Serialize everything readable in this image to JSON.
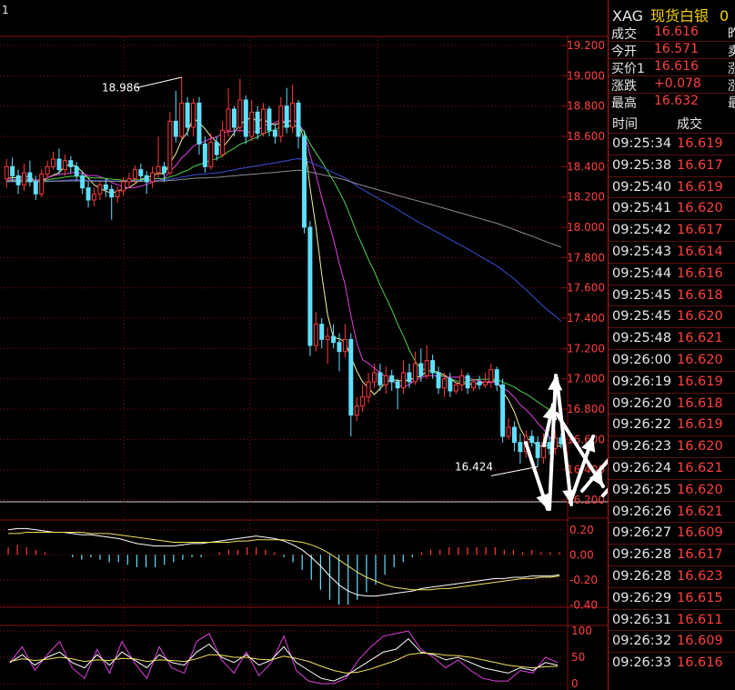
{
  "chart_data": {
    "type": "candlestick",
    "top_left_label": "1",
    "price_axis": {
      "ticks": [
        "19.200",
        "19.000",
        "18.800",
        "18.600",
        "18.400",
        "18.200",
        "18.000",
        "17.800",
        "17.600",
        "17.400",
        "17.200",
        "17.000",
        "16.800",
        "16.600",
        "16.400",
        "16.200"
      ],
      "range": [
        16.2,
        19.2
      ]
    },
    "annotations": {
      "high": "18.986",
      "low": "16.424"
    },
    "macd_axis": {
      "ticks": [
        "0.20",
        "0.00",
        "-0.20",
        "-0.40"
      ]
    },
    "kdj_axis": {
      "ticks": [
        "100",
        "50",
        "0"
      ]
    },
    "candles": [
      [
        18.32,
        18.4,
        18.45,
        18.26
      ],
      [
        18.4,
        18.34,
        18.46,
        18.3
      ],
      [
        18.34,
        18.28,
        18.38,
        18.22
      ],
      [
        18.28,
        18.36,
        18.42,
        18.24
      ],
      [
        18.36,
        18.3,
        18.44,
        18.27
      ],
      [
        18.3,
        18.22,
        18.34,
        18.18
      ],
      [
        18.22,
        18.35,
        18.38,
        18.2
      ],
      [
        18.35,
        18.4,
        18.44,
        18.32
      ],
      [
        18.4,
        18.45,
        18.5,
        18.38
      ],
      [
        18.45,
        18.38,
        18.52,
        18.35
      ],
      [
        18.38,
        18.44,
        18.48,
        18.34
      ],
      [
        18.44,
        18.4,
        18.47,
        18.36
      ],
      [
        18.4,
        18.34,
        18.43,
        18.31
      ],
      [
        18.34,
        18.26,
        18.37,
        18.22
      ],
      [
        18.26,
        18.18,
        18.3,
        18.13
      ],
      [
        18.18,
        18.22,
        18.26,
        18.14
      ],
      [
        18.22,
        18.28,
        18.3,
        18.18
      ],
      [
        18.28,
        18.25,
        18.32,
        18.2
      ],
      [
        18.25,
        18.2,
        18.28,
        18.05
      ],
      [
        18.2,
        18.24,
        18.27,
        18.16
      ],
      [
        18.24,
        18.3,
        18.33,
        18.21
      ],
      [
        18.3,
        18.32,
        18.36,
        18.26
      ],
      [
        18.32,
        18.38,
        18.41,
        18.28
      ],
      [
        18.38,
        18.34,
        18.42,
        18.3
      ],
      [
        18.34,
        18.3,
        18.37,
        18.22
      ],
      [
        18.3,
        18.36,
        18.4,
        18.26
      ],
      [
        18.36,
        18.4,
        18.6,
        18.33
      ],
      [
        18.4,
        18.36,
        18.43,
        18.3
      ],
      [
        18.36,
        18.7,
        18.76,
        18.34
      ],
      [
        18.7,
        18.6,
        18.9,
        18.56
      ],
      [
        18.6,
        18.82,
        18.99,
        18.58
      ],
      [
        18.82,
        18.66,
        18.86,
        18.6
      ],
      [
        18.66,
        18.82,
        18.85,
        18.6
      ],
      [
        18.82,
        18.55,
        18.86,
        18.48
      ],
      [
        18.55,
        18.4,
        18.6,
        18.36
      ],
      [
        18.4,
        18.56,
        18.62,
        18.38
      ],
      [
        18.56,
        18.48,
        18.6,
        18.44
      ],
      [
        18.48,
        18.64,
        18.7,
        18.46
      ],
      [
        18.64,
        18.78,
        18.92,
        18.6
      ],
      [
        18.78,
        18.66,
        18.8,
        18.6
      ],
      [
        18.66,
        18.84,
        18.98,
        18.63
      ],
      [
        18.84,
        18.6,
        18.87,
        18.55
      ],
      [
        18.6,
        18.76,
        18.84,
        18.57
      ],
      [
        18.76,
        18.62,
        18.8,
        18.58
      ],
      [
        18.62,
        18.78,
        18.82,
        18.6
      ],
      [
        18.78,
        18.64,
        18.8,
        18.6
      ],
      [
        18.64,
        18.6,
        18.68,
        18.55
      ],
      [
        18.6,
        18.8,
        18.86,
        18.56
      ],
      [
        18.8,
        18.66,
        18.92,
        18.62
      ],
      [
        18.66,
        18.82,
        18.94,
        18.62
      ],
      [
        18.82,
        18.6,
        18.84,
        18.52
      ],
      [
        18.6,
        18.0,
        18.64,
        17.96
      ],
      [
        18.0,
        17.22,
        18.04,
        17.15
      ],
      [
        17.22,
        17.36,
        17.44,
        17.18
      ],
      [
        17.36,
        17.26,
        17.4,
        17.2
      ],
      [
        17.26,
        17.28,
        17.34,
        17.1
      ],
      [
        17.28,
        17.24,
        17.36,
        17.2
      ],
      [
        17.24,
        17.18,
        17.3,
        17.05
      ],
      [
        17.18,
        17.26,
        17.36,
        17.14
      ],
      [
        17.26,
        16.76,
        17.3,
        16.62
      ],
      [
        16.76,
        16.82,
        16.88,
        16.72
      ],
      [
        16.82,
        16.88,
        16.96,
        16.78
      ],
      [
        16.88,
        16.98,
        17.04,
        16.84
      ],
      [
        16.98,
        17.04,
        17.1,
        16.94
      ],
      [
        17.04,
        16.96,
        17.1,
        16.92
      ],
      [
        16.96,
        17.02,
        17.08,
        16.9
      ],
      [
        17.02,
        16.98,
        17.06,
        16.92
      ],
      [
        16.98,
        16.94,
        17.0,
        16.8
      ],
      [
        16.94,
        17.04,
        17.12,
        16.9
      ],
      [
        17.04,
        16.98,
        17.1,
        16.94
      ],
      [
        16.98,
        17.1,
        17.18,
        16.96
      ],
      [
        17.1,
        17.02,
        17.2,
        16.98
      ],
      [
        17.02,
        17.12,
        17.22,
        17.0
      ],
      [
        17.12,
        17.04,
        17.16,
        17.0
      ],
      [
        17.04,
        16.94,
        17.08,
        16.9
      ],
      [
        16.94,
        17.0,
        17.04,
        16.88
      ],
      [
        17.0,
        16.92,
        17.04,
        16.88
      ],
      [
        16.92,
        16.96,
        16.98,
        16.9
      ],
      [
        16.96,
        17.02,
        17.06,
        16.92
      ],
      [
        17.02,
        16.94,
        17.04,
        16.9
      ],
      [
        16.94,
        16.98,
        17.0,
        16.92
      ],
      [
        16.98,
        16.96,
        17.02,
        16.93
      ],
      [
        16.96,
        16.98,
        17.04,
        16.94
      ],
      [
        16.98,
        17.06,
        17.1,
        16.94
      ],
      [
        17.06,
        16.96,
        17.08,
        16.92
      ],
      [
        16.96,
        16.62,
        17.0,
        16.58
      ],
      [
        16.62,
        16.68,
        16.74,
        16.6
      ],
      [
        16.68,
        16.58,
        16.72,
        16.52
      ],
      [
        16.58,
        16.52,
        16.64,
        16.44
      ],
      [
        16.52,
        16.62,
        16.66,
        16.48
      ],
      [
        16.62,
        16.58,
        16.66,
        16.55
      ],
      [
        16.58,
        16.48,
        16.62,
        16.42
      ],
      [
        16.48,
        16.58,
        16.64,
        16.44
      ],
      [
        16.58,
        16.54,
        16.62,
        16.5
      ],
      [
        16.54,
        16.61,
        16.66,
        16.5
      ],
      [
        16.61,
        16.57,
        16.64,
        16.54
      ]
    ],
    "macd": {
      "dif": [
        0.2,
        0.21,
        0.21,
        0.2,
        0.19,
        0.18,
        0.18,
        0.17,
        0.16,
        0.16,
        0.15,
        0.14,
        0.13,
        0.11,
        0.09,
        0.08,
        0.07,
        0.07,
        0.07,
        0.08,
        0.09,
        0.09,
        0.1,
        0.11,
        0.12,
        0.13,
        0.14,
        0.15,
        0.14,
        0.13,
        0.11,
        0.08,
        0.04,
        -0.02,
        -0.09,
        -0.17,
        -0.24,
        -0.29,
        -0.32,
        -0.33,
        -0.33,
        -0.32,
        -0.31,
        -0.3,
        -0.29,
        -0.27,
        -0.26,
        -0.25,
        -0.24,
        -0.23,
        -0.22,
        -0.21,
        -0.2,
        -0.19,
        -0.19,
        -0.18,
        -0.18,
        -0.17,
        -0.17,
        -0.17,
        -0.16
      ],
      "dea": [
        0.17,
        0.17,
        0.18,
        0.18,
        0.18,
        0.18,
        0.18,
        0.18,
        0.18,
        0.17,
        0.17,
        0.17,
        0.16,
        0.15,
        0.14,
        0.13,
        0.12,
        0.11,
        0.1,
        0.1,
        0.1,
        0.1,
        0.1,
        0.1,
        0.1,
        0.11,
        0.11,
        0.12,
        0.12,
        0.12,
        0.12,
        0.11,
        0.1,
        0.08,
        0.05,
        0.01,
        -0.04,
        -0.09,
        -0.14,
        -0.18,
        -0.21,
        -0.24,
        -0.26,
        -0.27,
        -0.28,
        -0.28,
        -0.28,
        -0.27,
        -0.27,
        -0.26,
        -0.25,
        -0.24,
        -0.23,
        -0.22,
        -0.21,
        -0.2,
        -0.19,
        -0.19,
        -0.18,
        -0.18,
        -0.17
      ]
    },
    "kdj": {
      "k": [
        40,
        55,
        35,
        50,
        60,
        40,
        30,
        55,
        35,
        60,
        45,
        30,
        55,
        40,
        35,
        60,
        75,
        50,
        40,
        55,
        35,
        45,
        70,
        40,
        25,
        10,
        5,
        15,
        30,
        45,
        60,
        65,
        85,
        60,
        55,
        45,
        50,
        40,
        30,
        25,
        20,
        30,
        25,
        40,
        35
      ],
      "d": [
        42,
        47,
        44,
        46,
        50,
        47,
        42,
        45,
        44,
        48,
        47,
        42,
        45,
        44,
        42,
        47,
        55,
        54,
        50,
        50,
        46,
        45,
        52,
        48,
        42,
        33,
        25,
        20,
        22,
        28,
        36,
        44,
        55,
        58,
        57,
        54,
        53,
        50,
        45,
        40,
        35,
        32,
        30,
        32,
        33
      ],
      "j": [
        40,
        70,
        25,
        55,
        80,
        30,
        10,
        65,
        20,
        80,
        40,
        10,
        70,
        30,
        20,
        80,
        95,
        45,
        20,
        60,
        15,
        40,
        90,
        25,
        5,
        0,
        0,
        10,
        45,
        70,
        90,
        95,
        100,
        65,
        50,
        30,
        45,
        25,
        10,
        5,
        5,
        25,
        20,
        50,
        40
      ]
    }
  },
  "panel": {
    "symbol": "XAG",
    "name": "现货白银",
    "name_trail": "0",
    "quote_rows": [
      {
        "label": "成交",
        "value": "16.616",
        "trail": "昨"
      },
      {
        "label": "今开",
        "value": "16.571",
        "trail": "卖"
      },
      {
        "label": "买价1",
        "value": "16.616",
        "trail": "涨"
      },
      {
        "label": "涨跌",
        "value": "+0.078",
        "trail": "涨"
      },
      {
        "label": "最高",
        "value": "16.632",
        "trail": "最"
      }
    ],
    "ticks_header": {
      "time": "时间",
      "price": "成交"
    },
    "ticks": [
      {
        "time": "09:25:34",
        "price": "16.619"
      },
      {
        "time": "09:25:38",
        "price": "16.617"
      },
      {
        "time": "09:25:40",
        "price": "16.619"
      },
      {
        "time": "09:25:41",
        "price": "16.620"
      },
      {
        "time": "09:25:42",
        "price": "16.617"
      },
      {
        "time": "09:25:43",
        "price": "16.614"
      },
      {
        "time": "09:25:44",
        "price": "16.616"
      },
      {
        "time": "09:25:45",
        "price": "16.618"
      },
      {
        "time": "09:25:45",
        "price": "16.620"
      },
      {
        "time": "09:25:48",
        "price": "16.621"
      },
      {
        "time": "09:26:00",
        "price": "16.620"
      },
      {
        "time": "09:26:19",
        "price": "16.619"
      },
      {
        "time": "09:26:20",
        "price": "16.618"
      },
      {
        "time": "09:26:22",
        "price": "16.619"
      },
      {
        "time": "09:26:23",
        "price": "16.620"
      },
      {
        "time": "09:26:24",
        "price": "16.621"
      },
      {
        "time": "09:26:25",
        "price": "16.620"
      },
      {
        "time": "09:26:26",
        "price": "16.621"
      },
      {
        "time": "09:26:27",
        "price": "16.609"
      },
      {
        "time": "09:26:28",
        "price": "16.617"
      },
      {
        "time": "09:26:28",
        "price": "16.623"
      },
      {
        "time": "09:26:29",
        "price": "16.615"
      },
      {
        "time": "09:26:31",
        "price": "16.611"
      },
      {
        "time": "09:26:32",
        "price": "16.609"
      },
      {
        "time": "09:26:33",
        "price": "16.616"
      }
    ]
  },
  "colors": {
    "background": "#000000",
    "grid": "#8a1010",
    "up": "#ff3b3b",
    "down": "#5fe0ff",
    "ma5": "#f2f2a0",
    "ma10": "#e040e0",
    "ma20": "#4fd24f",
    "ma60": "#3a4fd8",
    "ma120": "#8c8c8c",
    "price_text": "#ff4040",
    "label_text": "#e8e8e8",
    "symbol_name": "#f5d000"
  }
}
